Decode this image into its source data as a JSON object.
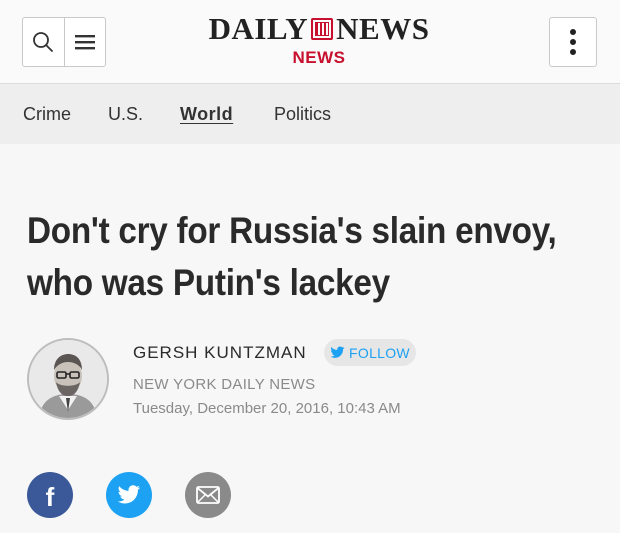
{
  "header": {
    "logo_left": "DAILY",
    "logo_right": "NEWS",
    "logo_sub": "NEWS",
    "icons": [
      "search-icon",
      "hamburger-menu-icon",
      "more-vertical-icon"
    ]
  },
  "nav": {
    "items": [
      "Crime",
      "U.S.",
      "World",
      "Politics"
    ],
    "active": "World"
  },
  "article": {
    "headline_line1": "Don't cry for Russia's slain envoy,",
    "headline_line2": "who was Putin's lackey",
    "author": "GERSH KUNTZMAN",
    "follow_label": "FOLLOW",
    "outlet": "NEW YORK DAILY NEWS",
    "timestamp": "Tuesday, December 20, 2016, 10:43 AM"
  },
  "share": {
    "icons": [
      "facebook-icon",
      "twitter-icon",
      "email-icon"
    ]
  },
  "colors": {
    "brand_red": "#c8102e",
    "facebook_blue": "#3b5998",
    "twitter_blue": "#1da1f2",
    "email_gray": "#8a8a8a"
  }
}
